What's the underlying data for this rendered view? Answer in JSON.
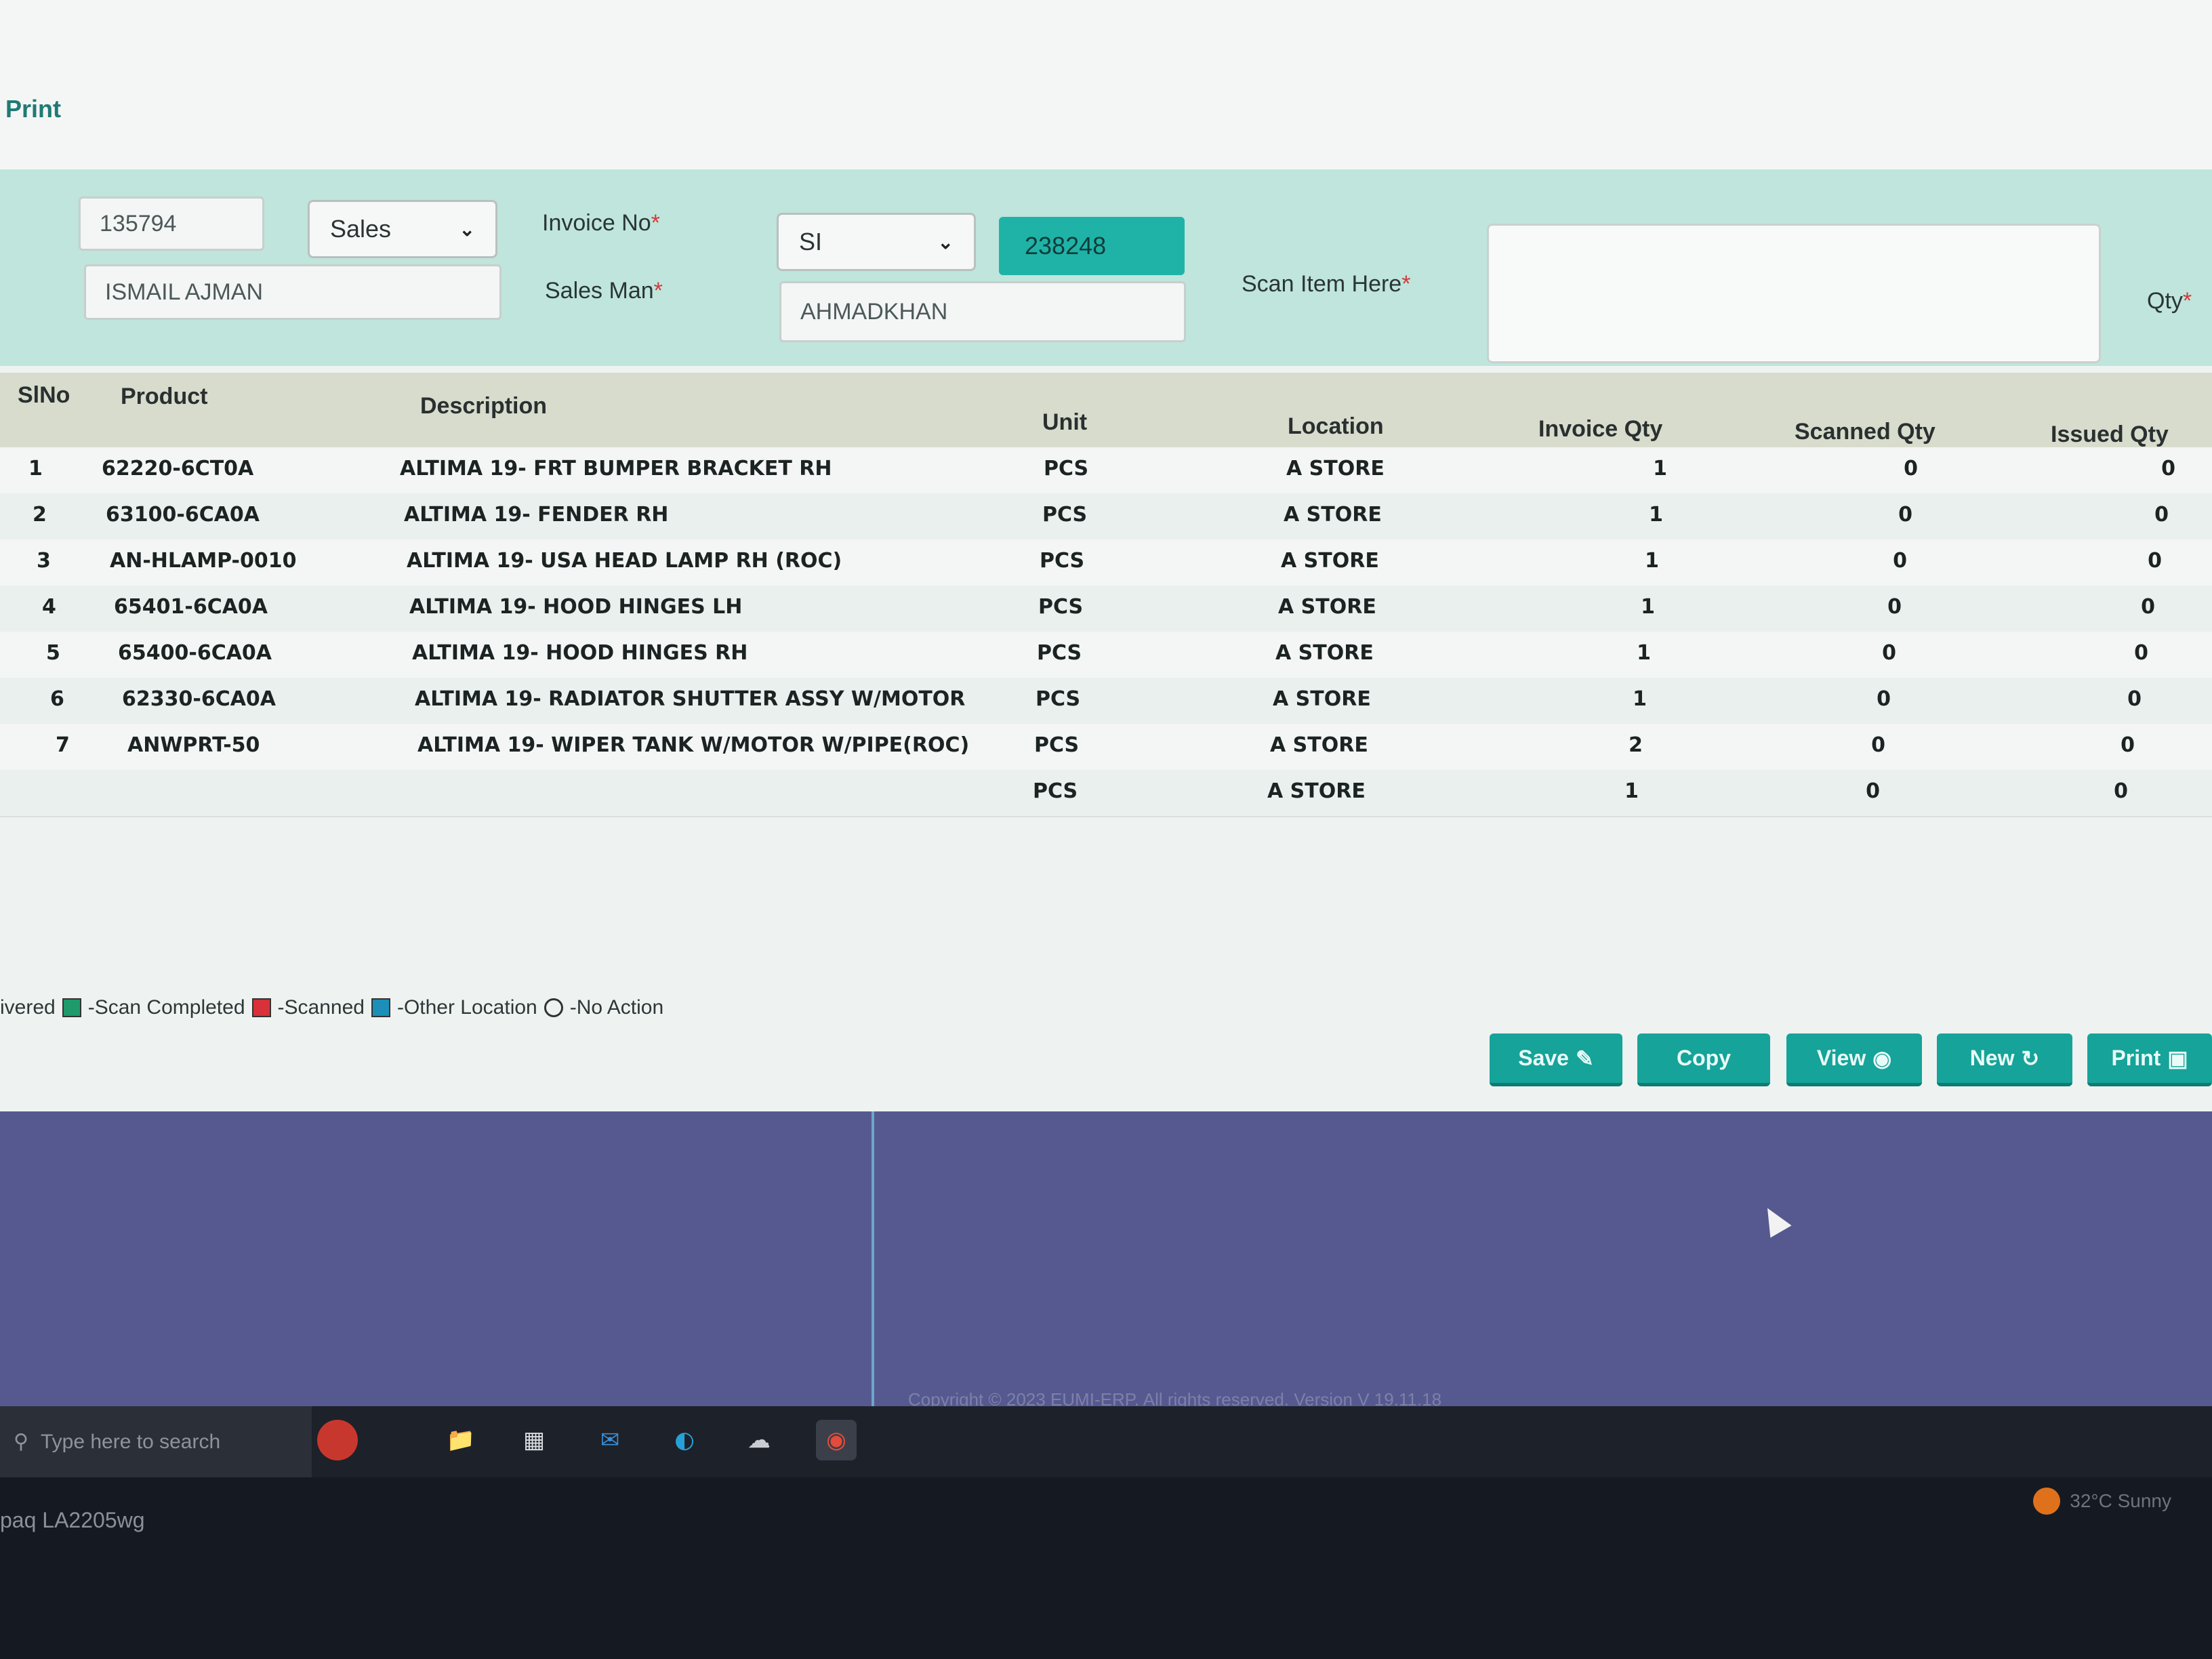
{
  "header": {
    "print_label": "Print"
  },
  "form": {
    "customer_code": "135794",
    "customer_name": "ISMAIL AJMAN",
    "doc_type": "Sales",
    "invoice_label": "Invoice No",
    "invoice_prefix": "SI",
    "invoice_number": "238248",
    "salesman_label": "Sales Man",
    "salesman": "AHMADKHAN",
    "scan_label": "Scan Item Here",
    "qty_label": "Qty",
    "required_mark": "*"
  },
  "table": {
    "columns": [
      "SlNo",
      "Product",
      "Description",
      "Unit",
      "Location",
      "Invoice Qty",
      "Scanned Qty",
      "Issued Qty"
    ],
    "rows": [
      [
        "1",
        "62220-6CT0A",
        "ALTIMA 19- FRT BUMPER BRACKET RH",
        "PCS",
        "A STORE",
        "1",
        "0",
        "0"
      ],
      [
        "2",
        "63100-6CA0A",
        "ALTIMA 19- FENDER RH",
        "PCS",
        "A STORE",
        "1",
        "0",
        "0"
      ],
      [
        "3",
        "AN-HLAMP-0010",
        "ALTIMA 19- USA HEAD LAMP RH (ROC)",
        "PCS",
        "A STORE",
        "1",
        "0",
        "0"
      ],
      [
        "4",
        "65401-6CA0A",
        "ALTIMA 19- HOOD HINGES LH",
        "PCS",
        "A STORE",
        "1",
        "0",
        "0"
      ],
      [
        "5",
        "65400-6CA0A",
        "ALTIMA 19- HOOD HINGES RH",
        "PCS",
        "A STORE",
        "1",
        "0",
        "0"
      ],
      [
        "6",
        "62330-6CA0A",
        "ALTIMA 19- RADIATOR SHUTTER ASSY W/MOTOR",
        "PCS",
        "A STORE",
        "1",
        "0",
        "0"
      ],
      [
        "7",
        "ANWPRT-50",
        "ALTIMA 19- WIPER TANK W/MOTOR W/PIPE(ROC)",
        "PCS",
        "A STORE",
        "2",
        "0",
        "0"
      ],
      [
        "",
        "",
        "",
        "PCS",
        "A STORE",
        "1",
        "0",
        "0"
      ]
    ]
  },
  "legend": {
    "items": [
      {
        "label": "ivered",
        "color": ""
      },
      {
        "label": "-Scan Completed",
        "color": "#1f9a6b"
      },
      {
        "label": "-Scanned",
        "color": "#d8313a"
      },
      {
        "label": "-Other Location",
        "color": "#1c8fb8"
      },
      {
        "label": "-No Action",
        "color": ""
      }
    ]
  },
  "buttons": {
    "save": "Save",
    "copy": "Copy",
    "view": "View",
    "new": "New",
    "print": "Print"
  },
  "footer": {
    "copyright": "Copyright © 2023 EUMI-ERP. All rights reserved. Version V 19.11.18"
  },
  "taskbar": {
    "search_placeholder": "Type here to search",
    "weather": "32°C Sunny"
  },
  "monitor": {
    "model_label": "paq LA2205wg"
  },
  "colors": {
    "accent": "#16a399",
    "band": "#bfe5dc",
    "lower": "#56598f"
  }
}
